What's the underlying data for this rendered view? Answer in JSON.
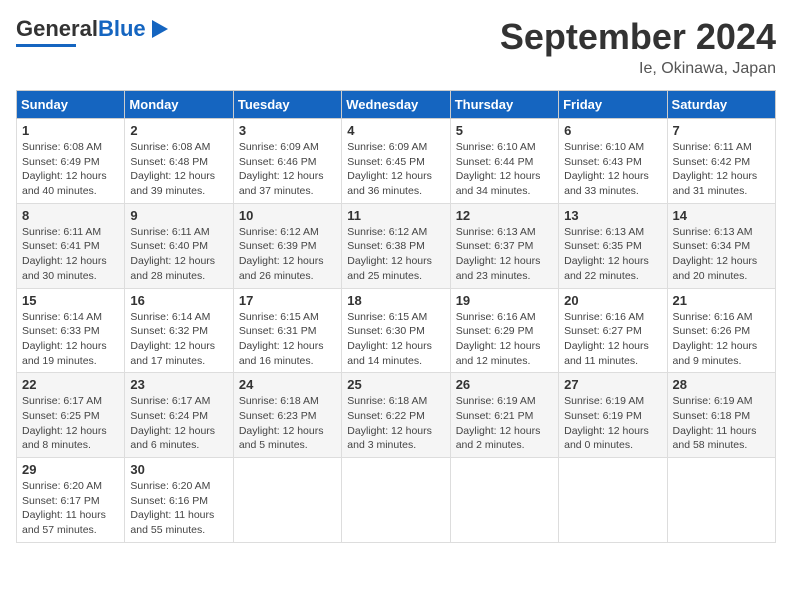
{
  "header": {
    "logo_text_general": "General",
    "logo_text_blue": "Blue",
    "month_title": "September 2024",
    "location": "Ie, Okinawa, Japan"
  },
  "calendar": {
    "days_of_week": [
      "Sunday",
      "Monday",
      "Tuesday",
      "Wednesday",
      "Thursday",
      "Friday",
      "Saturday"
    ],
    "weeks": [
      [
        {
          "day": "1",
          "sunrise": "Sunrise: 6:08 AM",
          "sunset": "Sunset: 6:49 PM",
          "daylight": "Daylight: 12 hours and 40 minutes."
        },
        {
          "day": "2",
          "sunrise": "Sunrise: 6:08 AM",
          "sunset": "Sunset: 6:48 PM",
          "daylight": "Daylight: 12 hours and 39 minutes."
        },
        {
          "day": "3",
          "sunrise": "Sunrise: 6:09 AM",
          "sunset": "Sunset: 6:46 PM",
          "daylight": "Daylight: 12 hours and 37 minutes."
        },
        {
          "day": "4",
          "sunrise": "Sunrise: 6:09 AM",
          "sunset": "Sunset: 6:45 PM",
          "daylight": "Daylight: 12 hours and 36 minutes."
        },
        {
          "day": "5",
          "sunrise": "Sunrise: 6:10 AM",
          "sunset": "Sunset: 6:44 PM",
          "daylight": "Daylight: 12 hours and 34 minutes."
        },
        {
          "day": "6",
          "sunrise": "Sunrise: 6:10 AM",
          "sunset": "Sunset: 6:43 PM",
          "daylight": "Daylight: 12 hours and 33 minutes."
        },
        {
          "day": "7",
          "sunrise": "Sunrise: 6:11 AM",
          "sunset": "Sunset: 6:42 PM",
          "daylight": "Daylight: 12 hours and 31 minutes."
        }
      ],
      [
        {
          "day": "8",
          "sunrise": "Sunrise: 6:11 AM",
          "sunset": "Sunset: 6:41 PM",
          "daylight": "Daylight: 12 hours and 30 minutes."
        },
        {
          "day": "9",
          "sunrise": "Sunrise: 6:11 AM",
          "sunset": "Sunset: 6:40 PM",
          "daylight": "Daylight: 12 hours and 28 minutes."
        },
        {
          "day": "10",
          "sunrise": "Sunrise: 6:12 AM",
          "sunset": "Sunset: 6:39 PM",
          "daylight": "Daylight: 12 hours and 26 minutes."
        },
        {
          "day": "11",
          "sunrise": "Sunrise: 6:12 AM",
          "sunset": "Sunset: 6:38 PM",
          "daylight": "Daylight: 12 hours and 25 minutes."
        },
        {
          "day": "12",
          "sunrise": "Sunrise: 6:13 AM",
          "sunset": "Sunset: 6:37 PM",
          "daylight": "Daylight: 12 hours and 23 minutes."
        },
        {
          "day": "13",
          "sunrise": "Sunrise: 6:13 AM",
          "sunset": "Sunset: 6:35 PM",
          "daylight": "Daylight: 12 hours and 22 minutes."
        },
        {
          "day": "14",
          "sunrise": "Sunrise: 6:13 AM",
          "sunset": "Sunset: 6:34 PM",
          "daylight": "Daylight: 12 hours and 20 minutes."
        }
      ],
      [
        {
          "day": "15",
          "sunrise": "Sunrise: 6:14 AM",
          "sunset": "Sunset: 6:33 PM",
          "daylight": "Daylight: 12 hours and 19 minutes."
        },
        {
          "day": "16",
          "sunrise": "Sunrise: 6:14 AM",
          "sunset": "Sunset: 6:32 PM",
          "daylight": "Daylight: 12 hours and 17 minutes."
        },
        {
          "day": "17",
          "sunrise": "Sunrise: 6:15 AM",
          "sunset": "Sunset: 6:31 PM",
          "daylight": "Daylight: 12 hours and 16 minutes."
        },
        {
          "day": "18",
          "sunrise": "Sunrise: 6:15 AM",
          "sunset": "Sunset: 6:30 PM",
          "daylight": "Daylight: 12 hours and 14 minutes."
        },
        {
          "day": "19",
          "sunrise": "Sunrise: 6:16 AM",
          "sunset": "Sunset: 6:29 PM",
          "daylight": "Daylight: 12 hours and 12 minutes."
        },
        {
          "day": "20",
          "sunrise": "Sunrise: 6:16 AM",
          "sunset": "Sunset: 6:27 PM",
          "daylight": "Daylight: 12 hours and 11 minutes."
        },
        {
          "day": "21",
          "sunrise": "Sunrise: 6:16 AM",
          "sunset": "Sunset: 6:26 PM",
          "daylight": "Daylight: 12 hours and 9 minutes."
        }
      ],
      [
        {
          "day": "22",
          "sunrise": "Sunrise: 6:17 AM",
          "sunset": "Sunset: 6:25 PM",
          "daylight": "Daylight: 12 hours and 8 minutes."
        },
        {
          "day": "23",
          "sunrise": "Sunrise: 6:17 AM",
          "sunset": "Sunset: 6:24 PM",
          "daylight": "Daylight: 12 hours and 6 minutes."
        },
        {
          "day": "24",
          "sunrise": "Sunrise: 6:18 AM",
          "sunset": "Sunset: 6:23 PM",
          "daylight": "Daylight: 12 hours and 5 minutes."
        },
        {
          "day": "25",
          "sunrise": "Sunrise: 6:18 AM",
          "sunset": "Sunset: 6:22 PM",
          "daylight": "Daylight: 12 hours and 3 minutes."
        },
        {
          "day": "26",
          "sunrise": "Sunrise: 6:19 AM",
          "sunset": "Sunset: 6:21 PM",
          "daylight": "Daylight: 12 hours and 2 minutes."
        },
        {
          "day": "27",
          "sunrise": "Sunrise: 6:19 AM",
          "sunset": "Sunset: 6:19 PM",
          "daylight": "Daylight: 12 hours and 0 minutes."
        },
        {
          "day": "28",
          "sunrise": "Sunrise: 6:19 AM",
          "sunset": "Sunset: 6:18 PM",
          "daylight": "Daylight: 11 hours and 58 minutes."
        }
      ],
      [
        {
          "day": "29",
          "sunrise": "Sunrise: 6:20 AM",
          "sunset": "Sunset: 6:17 PM",
          "daylight": "Daylight: 11 hours and 57 minutes."
        },
        {
          "day": "30",
          "sunrise": "Sunrise: 6:20 AM",
          "sunset": "Sunset: 6:16 PM",
          "daylight": "Daylight: 11 hours and 55 minutes."
        },
        null,
        null,
        null,
        null,
        null
      ]
    ]
  }
}
